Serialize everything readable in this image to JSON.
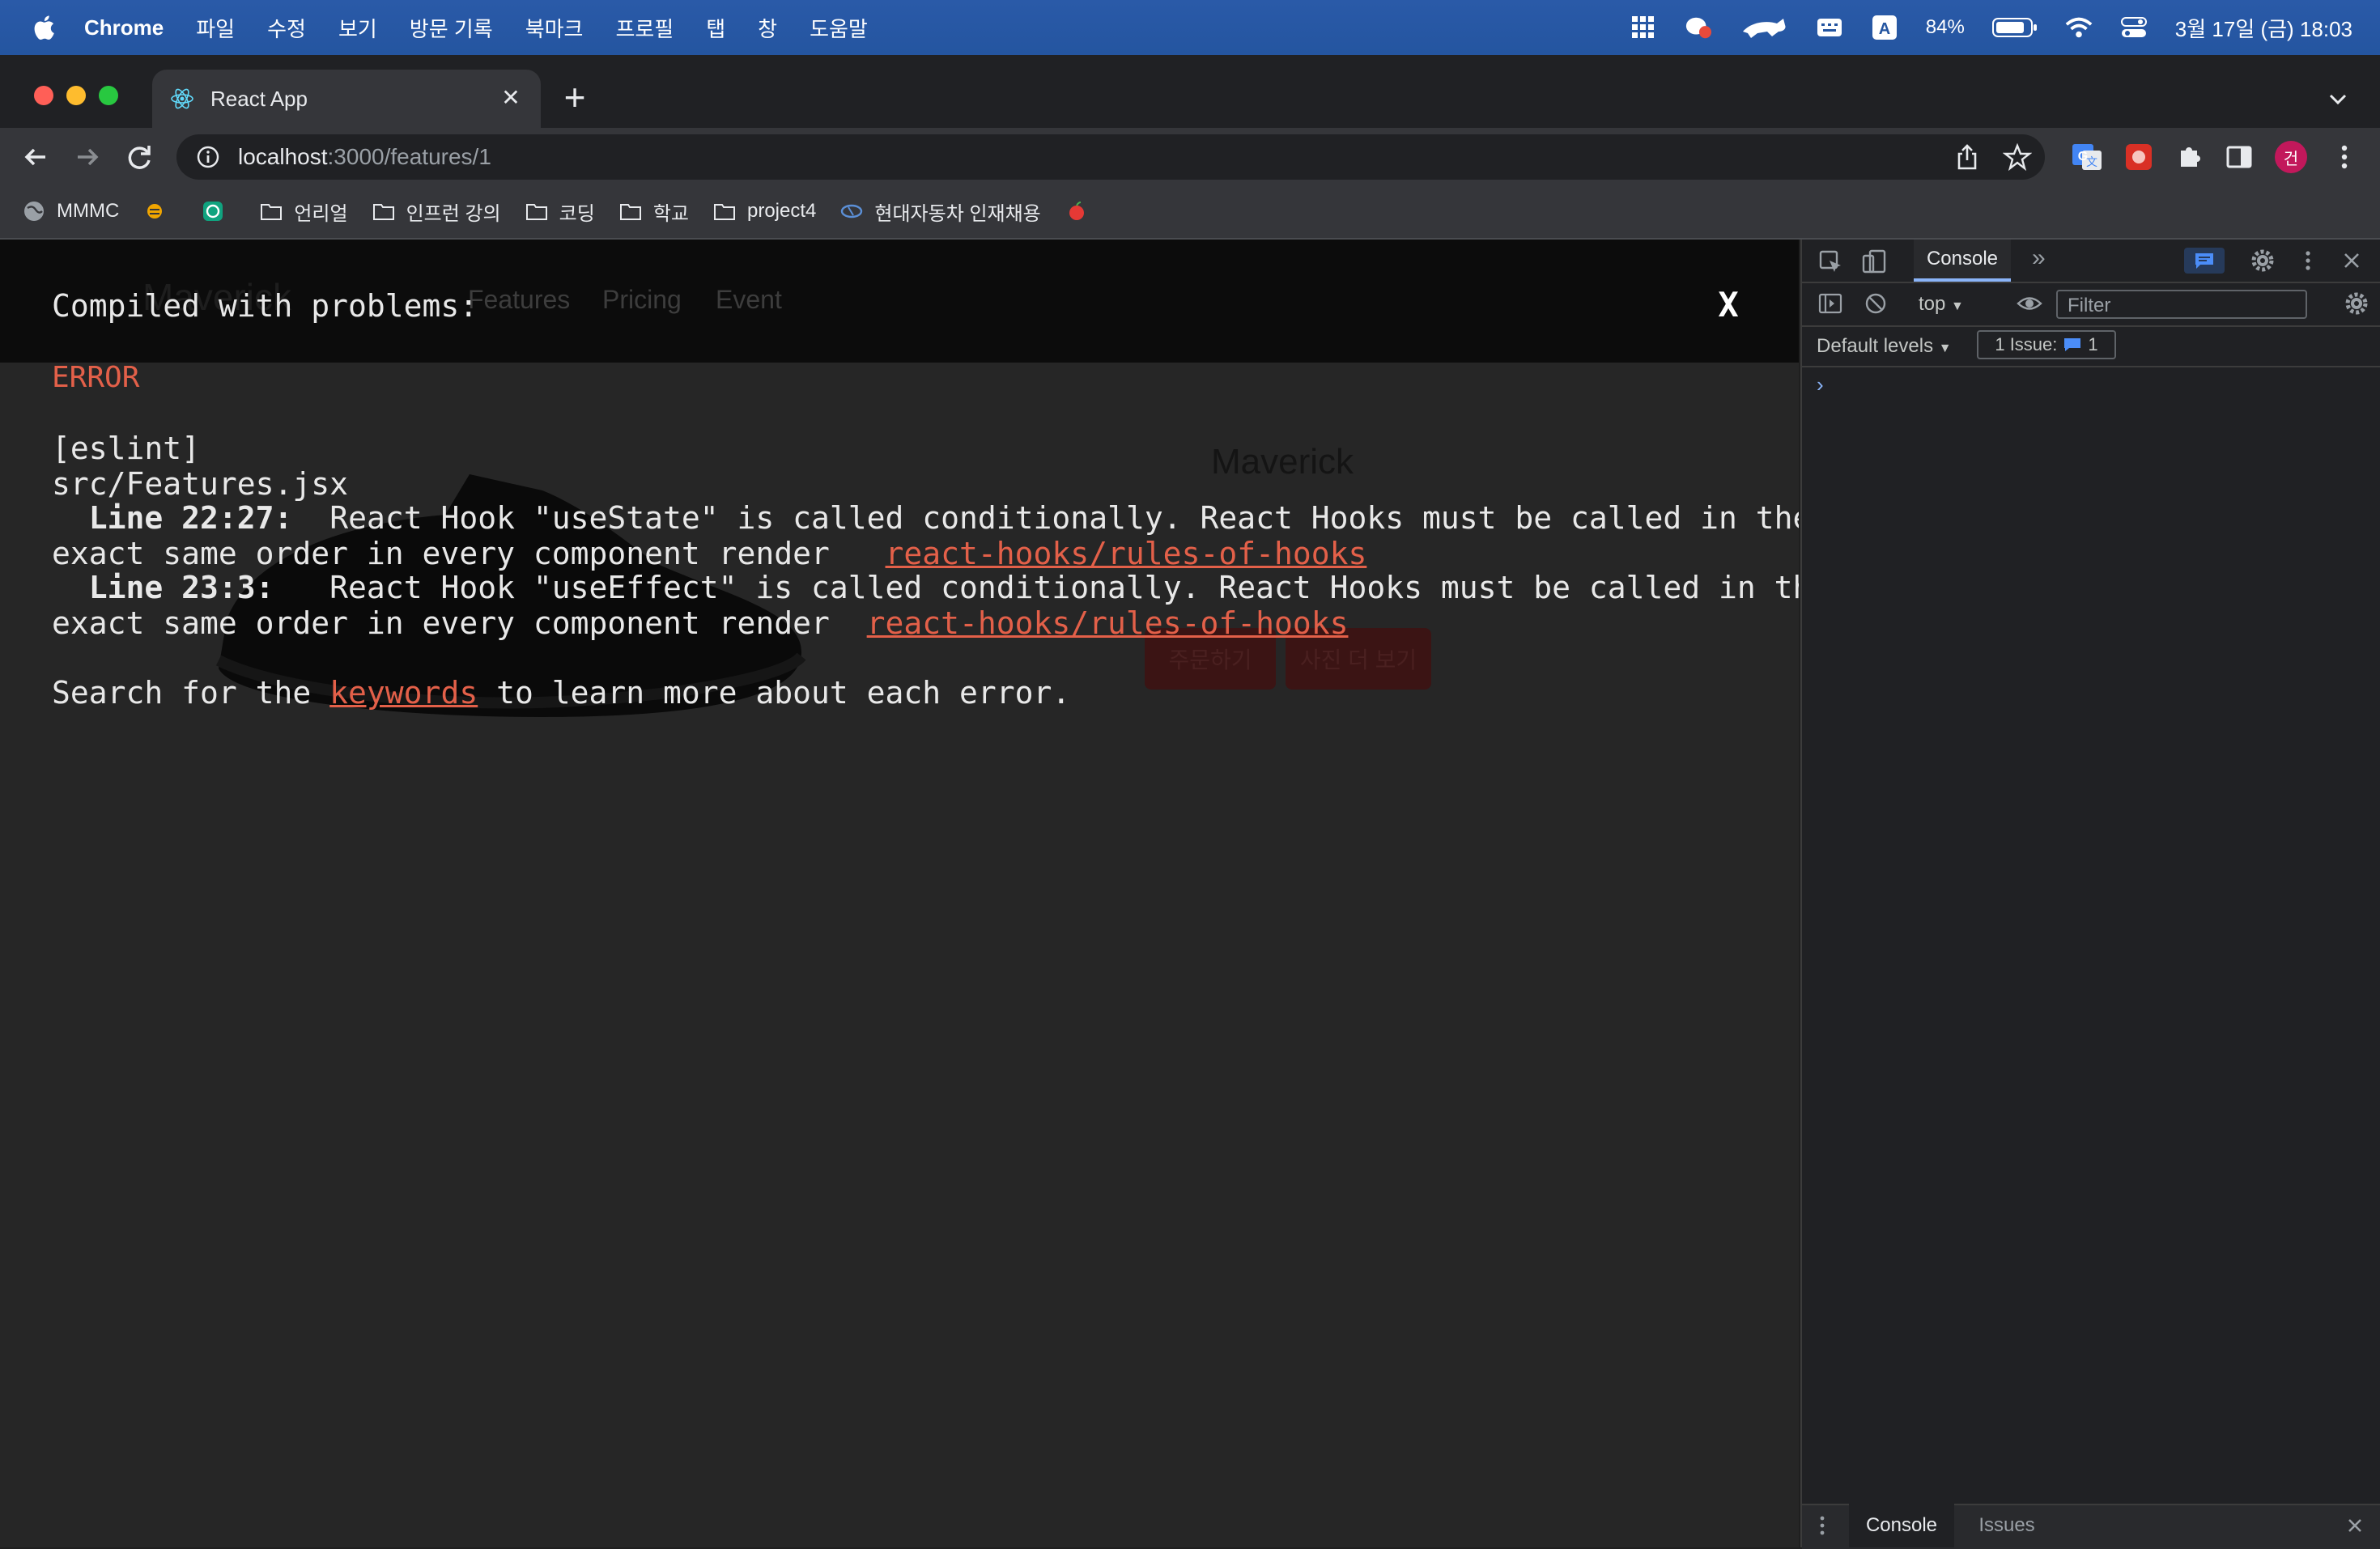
{
  "menubar": {
    "app": "Chrome",
    "items": [
      "파일",
      "수정",
      "보기",
      "방문 기록",
      "북마크",
      "프로필",
      "탭",
      "창",
      "도움말"
    ],
    "battery": "84%",
    "datetime": "3월 17일 (금) 18:03"
  },
  "browser": {
    "tab_title": "React App",
    "url_host": "localhost",
    "url_path": ":3000/features/1",
    "profile_initial": "건"
  },
  "bookmarks": [
    {
      "label": "MMMC",
      "icon": "globe-icon"
    },
    {
      "label": "",
      "icon": "bee-icon"
    },
    {
      "label": "",
      "icon": "openai-icon"
    },
    {
      "label": "언리얼",
      "icon": "folder-icon"
    },
    {
      "label": "인프런 강의",
      "icon": "folder-icon"
    },
    {
      "label": "코딩",
      "icon": "folder-icon"
    },
    {
      "label": "학교",
      "icon": "folder-icon"
    },
    {
      "label": "project4",
      "icon": "folder-icon"
    },
    {
      "label": "현대자동차 인재채용",
      "icon": "hyundai-icon"
    },
    {
      "label": "",
      "icon": "apple-fruit-icon"
    }
  ],
  "app_page": {
    "brand": "Maverick",
    "nav": [
      "Features",
      "Pricing",
      "Event"
    ],
    "product_title": "Maverick",
    "order_button": "주문하기",
    "more_photos_button": "사진 더 보기"
  },
  "overlay": {
    "title": "Compiled with problems:",
    "close": "X",
    "error_label": "ERROR",
    "source": "[eslint]",
    "file": "src/Features.jsx",
    "line1_loc": "Line 22:27:",
    "line1_msg_a": "  React Hook \"useState\" is called conditionally. React Hooks must be called in the",
    "line1_msg_b": "exact same order in every component render   ",
    "line1_rule": "react-hooks/rules-of-hooks",
    "line2_loc": "Line 23:3:",
    "line2_msg_a": "   React Hook \"useEffect\" is called conditionally. React Hooks must be called in the",
    "line2_msg_b": "exact same order in every component render  ",
    "line2_rule": "react-hooks/rules-of-hooks",
    "search_a": "Search for the ",
    "search_link": "keywords",
    "search_b": " to learn more about each error."
  },
  "devtools": {
    "active_tab": "Console",
    "context": "top",
    "filter_placeholder": "Filter",
    "levels": "Default levels",
    "issues_label": "1 Issue:",
    "issues_count": "1",
    "prompt": "›",
    "drawer_tabs": [
      "Console",
      "Issues"
    ]
  },
  "colors": {
    "error": "#e36049",
    "menubar": "#2455a0",
    "devtools_accent": "#8ab4f8"
  }
}
